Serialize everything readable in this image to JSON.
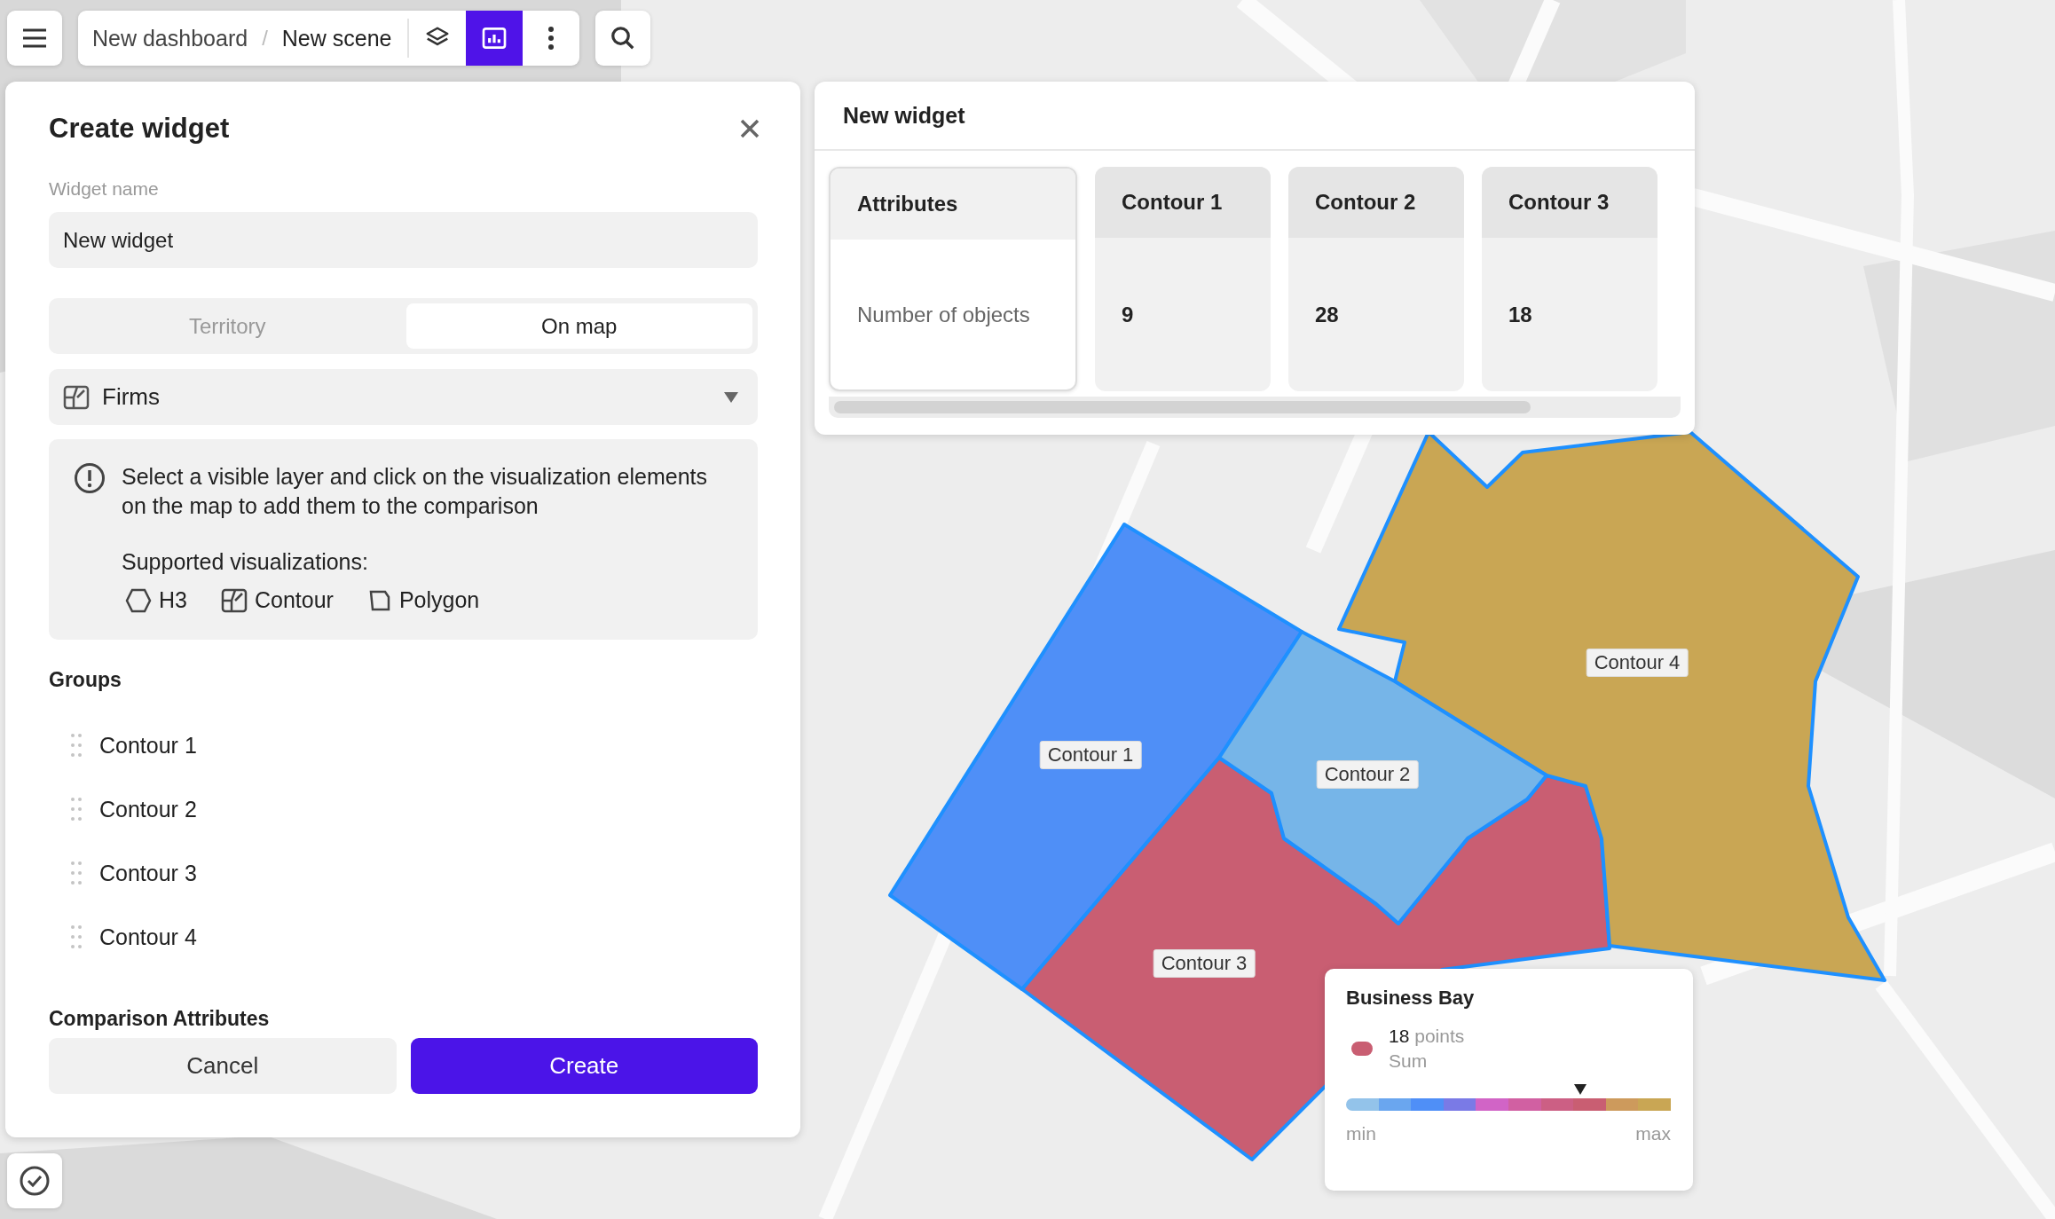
{
  "top_bar": {
    "breadcrumb": [
      "New dashboard",
      "New scene"
    ],
    "separator": "/",
    "tools": [
      {
        "kind": "layers",
        "selected": false
      },
      {
        "kind": "widgets",
        "selected": true
      },
      {
        "kind": "more",
        "selected": false
      }
    ]
  },
  "create_widget": {
    "title": "Create widget",
    "name_label": "Widget name",
    "name_value": "New widget",
    "modes": [
      {
        "label": "Territory",
        "selected": false
      },
      {
        "label": "On map",
        "selected": true
      }
    ],
    "layer": "Firms",
    "info": {
      "text": "Select a visible layer and click on the visualization elements on the map to add them to the comparison",
      "supported_label": "Supported visualizations:",
      "visualizations": [
        {
          "kind": "h3",
          "label": "H3"
        },
        {
          "kind": "contour",
          "label": "Contour"
        },
        {
          "kind": "polygon",
          "label": "Polygon"
        }
      ]
    },
    "groups_label": "Groups",
    "groups": [
      "Contour 1",
      "Contour 2",
      "Contour 3",
      "Contour 4"
    ],
    "attributes_label": "Comparison Attributes",
    "buttons": [
      {
        "kind": "cancel",
        "label": "Cancel"
      },
      {
        "kind": "create",
        "label": "Create"
      }
    ]
  },
  "widget": {
    "title": "New widget",
    "columns": [
      {
        "kind": "attribute",
        "header": "Attributes",
        "value": "Number of objects"
      },
      {
        "kind": "group",
        "header": "Contour 1",
        "value": "9"
      },
      {
        "kind": "group",
        "header": "Contour 2",
        "value": "28"
      },
      {
        "kind": "group",
        "header": "Contour 3",
        "value": "18"
      }
    ]
  },
  "map": {
    "contours": [
      {
        "label": "Contour 1",
        "color": "#4f8ff7"
      },
      {
        "label": "Contour 2",
        "color": "#76b5e8"
      },
      {
        "label": "Contour 3",
        "color": "#c95e72"
      },
      {
        "label": "Contour 4",
        "color": "#c9a654"
      }
    ]
  },
  "legend": {
    "title": "Business Bay",
    "color": "#c95e72",
    "count": "18",
    "unit": "points",
    "aggregation": "Sum",
    "level": 0.72,
    "min": "min",
    "max": "max",
    "scale": [
      {
        "color": "#93c3ea"
      },
      {
        "color": "#6aa6ef"
      },
      {
        "color": "#4f8ff7"
      },
      {
        "color": "#7a7ae6"
      },
      {
        "color": "#d164c6"
      },
      {
        "color": "#d160a2"
      },
      {
        "color": "#cc5f84"
      },
      {
        "color": "#c95e72"
      },
      {
        "color": "#cd9a5c"
      },
      {
        "color": "#c9a654"
      }
    ]
  }
}
